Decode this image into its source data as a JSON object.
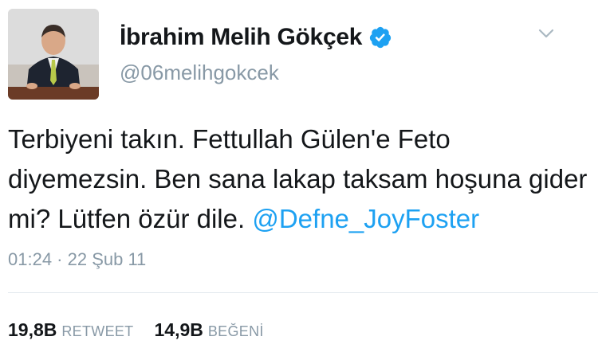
{
  "tweet": {
    "author": {
      "display_name": "İbrahim Melih Gökçek",
      "handle": "@06melihgokcek",
      "verified": true,
      "avatar_icon": "profile-photo"
    },
    "text": {
      "prefix": "Terbiyeni takın. Fettullah Gülen'e Feto diyemezsin. Ben sana lakap taksam hoşuna gider mi? Lütfen özür dile. ",
      "mention": "@Defne_JoyFoster"
    },
    "timestamp": "01:24 · 22 Şub 11",
    "stats": {
      "retweets": {
        "count": "19,8B",
        "label": "RETWEET"
      },
      "likes": {
        "count": "14,9B",
        "label": "BEĞENİ"
      }
    }
  },
  "colors": {
    "link": "#1da1f2",
    "secondary_text": "#8899a6",
    "verified_badge": "#1da1f2",
    "divider": "#e1e8ed"
  },
  "icons": {
    "verified": "verified-badge-icon",
    "menu": "chevron-down-icon"
  }
}
